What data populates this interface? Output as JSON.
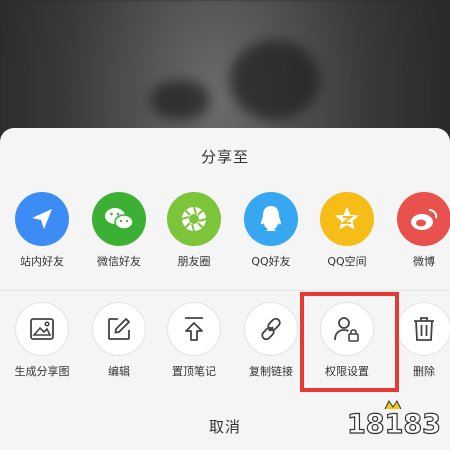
{
  "share_sheet": {
    "title": "分享至",
    "row1": [
      {
        "label": "站内好友",
        "icon": "send-icon",
        "color": "#3d8cf5"
      },
      {
        "label": "微信好友",
        "icon": "wechat-icon",
        "color": "#3cb034"
      },
      {
        "label": "朋友圈",
        "icon": "moments-icon",
        "color": "#7cc43a"
      },
      {
        "label": "QQ好友",
        "icon": "qq-icon",
        "color": "#38a7f2"
      },
      {
        "label": "QQ空间",
        "icon": "qzone-icon",
        "color": "#f5bd15"
      },
      {
        "label": "微博",
        "icon": "weibo-icon",
        "color": "#e9514f"
      }
    ],
    "row2": [
      {
        "label": "生成分享图",
        "icon": "image-icon"
      },
      {
        "label": "编辑",
        "icon": "edit-icon"
      },
      {
        "label": "置顶笔记",
        "icon": "pin-top-icon"
      },
      {
        "label": "复制链接",
        "icon": "link-icon"
      },
      {
        "label": "权限设置",
        "icon": "user-lock-icon"
      },
      {
        "label": "删除",
        "icon": "trash-icon"
      }
    ],
    "cancel_label": "取消"
  },
  "watermark": {
    "text": "18183"
  },
  "colors": {
    "highlight": "#e53935",
    "sheet_bg": "#f5f5f5"
  }
}
